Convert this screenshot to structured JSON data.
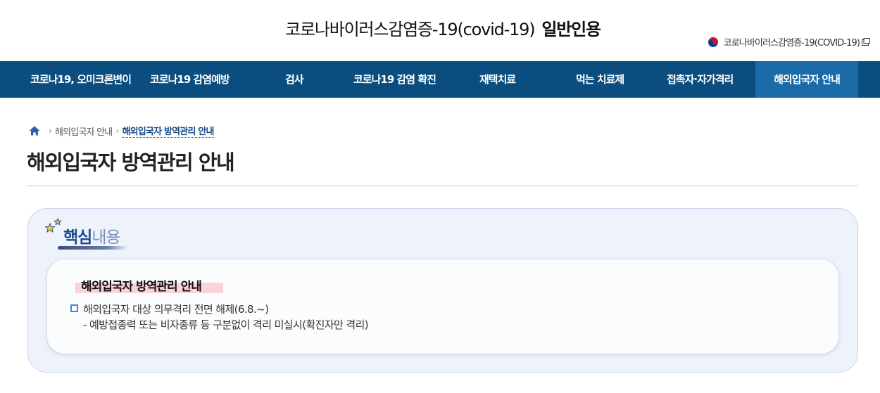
{
  "header": {
    "title_main": "코로나바이러스감염증-19(covid-19)",
    "title_sub": "일반인용",
    "util_link": "코로나바이러스감염증-19(COVID-19)"
  },
  "nav": {
    "items": [
      {
        "label": "코로나19, 오미크론변이"
      },
      {
        "label": "코로나19 감염예방"
      },
      {
        "label": "검사"
      },
      {
        "label": "코로나19 감염 확진"
      },
      {
        "label": "재택치료"
      },
      {
        "label": "먹는 치료제"
      },
      {
        "label": "접촉자·자가격리"
      },
      {
        "label": "해외입국자 안내"
      }
    ],
    "active_index": 7
  },
  "breadcrumb": {
    "home_icon": "home-icon",
    "level1": "해외입국자 안내",
    "current": "해외입국자 방역관리 안내"
  },
  "page_title": "해외입국자 방역관리 안내",
  "key_content": {
    "heading_strong": "핵심",
    "heading_light": "내용",
    "box_title": "해외입국자 방역관리 안내",
    "bullet": "해외입국자 대상 의무격리 전면 해제(6.8.~)",
    "bullet_sub": "- 예방접종력 또는 비자종류 등 구분없이 격리 미실시(확진자만 격리)"
  },
  "colors": {
    "nav_bg": "#0a4d7e",
    "nav_active": "#1a6ba8",
    "accent": "#174e8a",
    "highlight": "#fad3da"
  }
}
